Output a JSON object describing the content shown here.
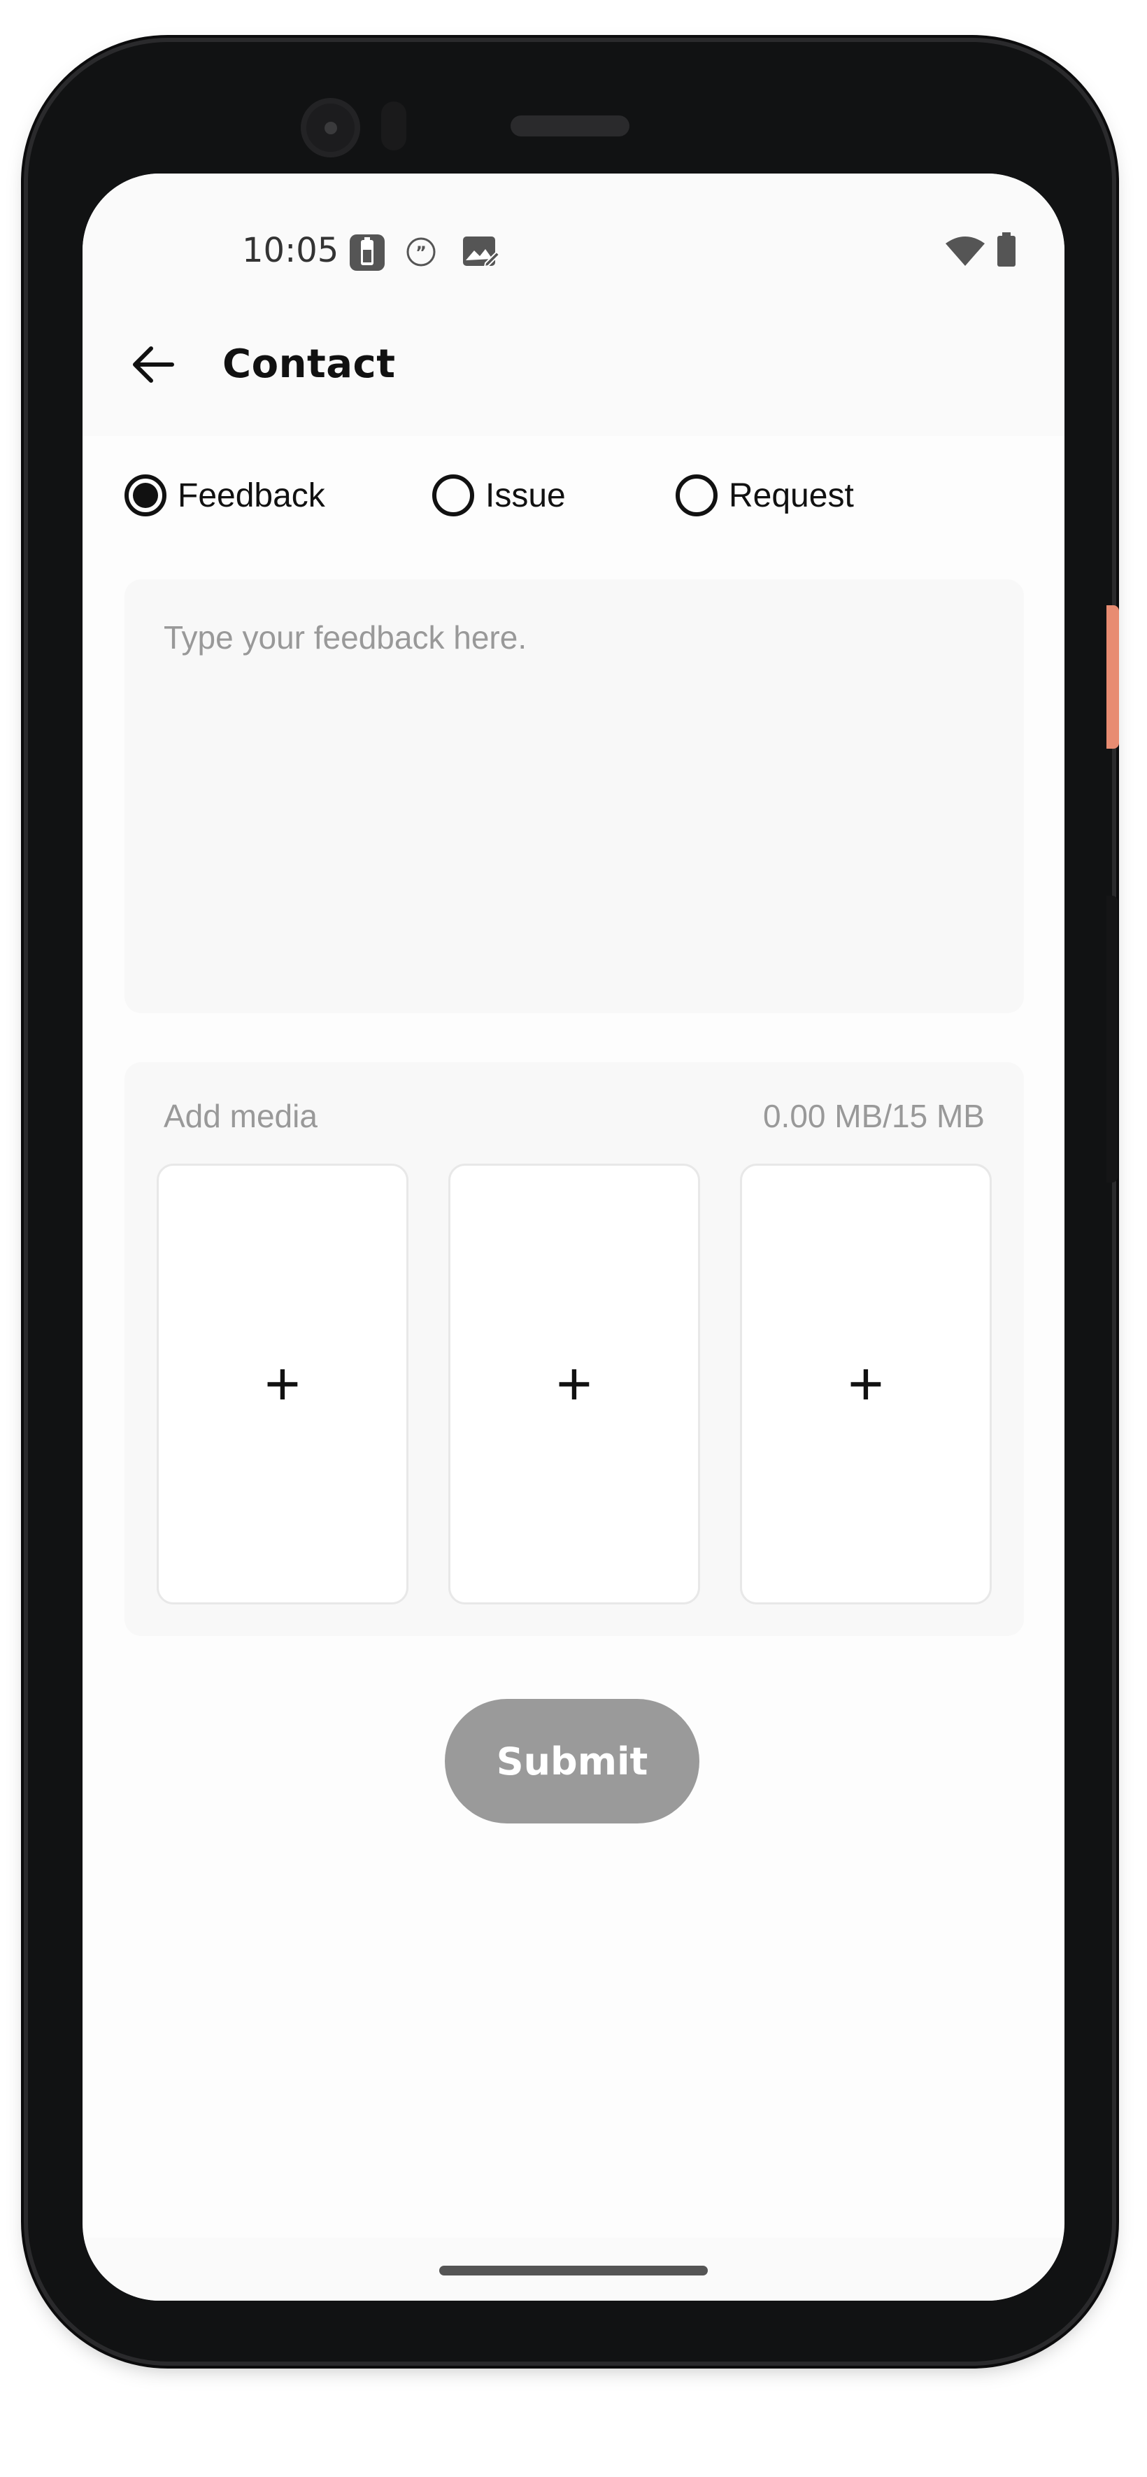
{
  "status_bar": {
    "time": "10:05",
    "icons": [
      "battery-saver-icon",
      "quote-icon",
      "edit-image-icon",
      "wifi-icon",
      "battery-icon"
    ]
  },
  "app_bar": {
    "title": "Contact",
    "back_icon": "arrow-left-icon"
  },
  "form": {
    "types": [
      {
        "label": "Feedback",
        "selected": true
      },
      {
        "label": "Issue",
        "selected": false
      },
      {
        "label": "Request",
        "selected": false
      }
    ],
    "message": {
      "value": "",
      "placeholder": "Type your feedback here."
    },
    "media": {
      "label": "Add media",
      "size": "0.00 MB/15 MB",
      "slot_symbol": "+"
    },
    "submit_label": "Submit"
  },
  "colors": {
    "submit_disabled": "#9a9a9a",
    "accent_side_button": "#e88c72",
    "surface": "#f8f8f8"
  }
}
